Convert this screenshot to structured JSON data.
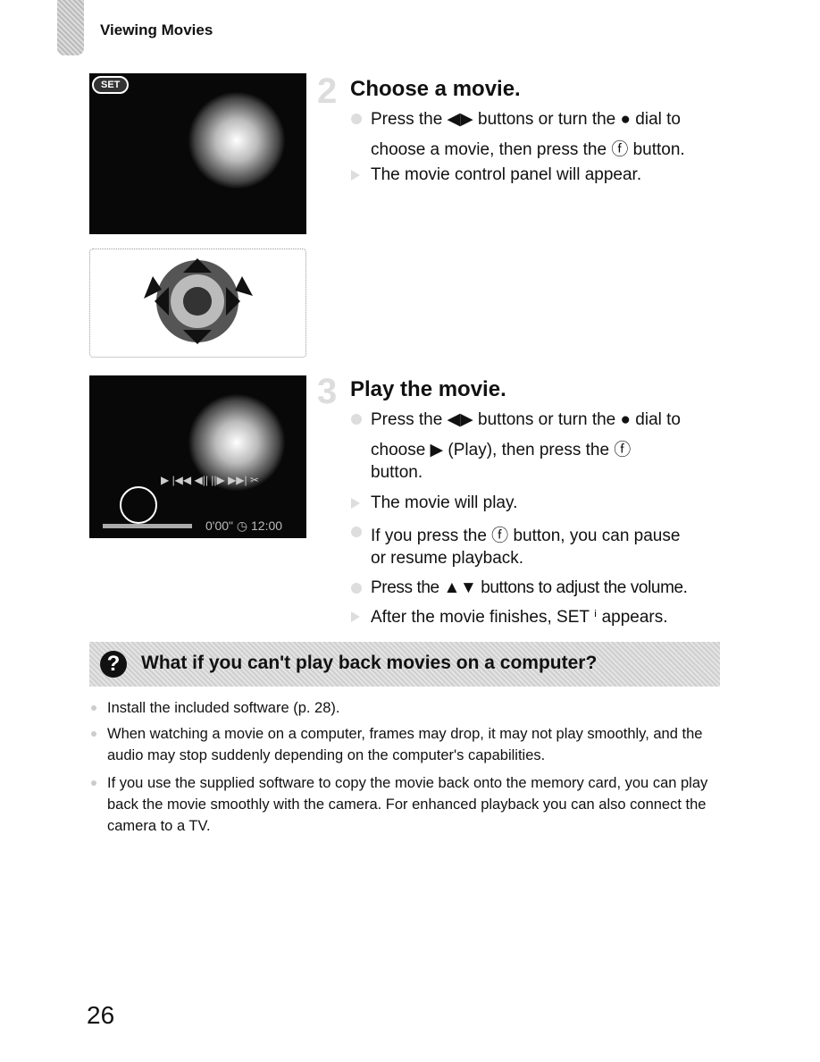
{
  "header": {
    "section": "Viewing Movies"
  },
  "photo1": {
    "badge": "SET"
  },
  "photo2": {
    "controls": "▶  |◀◀  ◀||  ||▶  ▶▶|  ✂",
    "time": "0'00\"  ◷ 12:00"
  },
  "step2": {
    "number": "2",
    "title": "Choose a movie.",
    "lines": [
      "Press the ◀▶ buttons or turn the ● dial to",
      "choose a movie, then press the ⓕ button.",
      "The movie control panel will appear."
    ]
  },
  "step3": {
    "number": "3",
    "title": "Play the movie.",
    "lines": [
      "Press the ◀▶ buttons or turn the ● dial to",
      "choose  ▶  (Play), then press the ⓕ",
      "button.",
      "The movie will play.",
      "If you press the ⓕ button, you can pause",
      "or resume playback.",
      "Press the ▲▼ buttons to adjust the volume.",
      "After the movie finishes, SET ⁱ appears."
    ]
  },
  "tipbox": {
    "title": "What if you can't play back movies on a computer?",
    "items": [
      "Install the included software (p. 28).",
      "When watching a movie on a computer, frames may drop, it may not play smoothly, and the audio may stop suddenly depending on the computer's capabilities.",
      "If you use the supplied software to copy the movie back onto the memory card, you can play back the movie smoothly with the camera. For enhanced playback you can also connect the camera to a TV."
    ]
  },
  "footer": {
    "page_number": "26"
  }
}
